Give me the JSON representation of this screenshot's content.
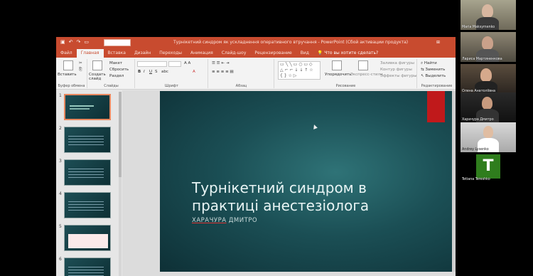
{
  "window": {
    "title": "Турнікетний синдром як ускладнення оперативного втручання - PowerPoint (Сбой активации продукта)",
    "tell_me": "Что вы хотите сделать?"
  },
  "tabs": [
    "Файл",
    "Главная",
    "Вставка",
    "Дизайн",
    "Переходы",
    "Анимация",
    "Слайд-шоу",
    "Рецензирование",
    "Вид"
  ],
  "active_tab": "Главная",
  "ribbon": {
    "clipboard": {
      "label": "Буфер обмена",
      "paste": "Вставить"
    },
    "slides": {
      "label": "Слайды",
      "new_slide": "Создать слайд",
      "layout": "Макет",
      "reset": "Сбросить",
      "section": "Раздел"
    },
    "font": {
      "label": "Шрифт"
    },
    "paragraph": {
      "label": "Абзац"
    },
    "drawing": {
      "label": "Рисование",
      "arrange": "Упорядочить",
      "quick_styles": "Экспресс-стили",
      "fill": "Заливка фигуры",
      "outline": "Контур фигуры",
      "effects": "Эффекты фигуры"
    },
    "editing": {
      "label": "Редактирование",
      "find": "Найти",
      "replace": "Заменить",
      "select": "Выделить"
    }
  },
  "thumbnails": [
    {
      "num": "1",
      "selected": true
    },
    {
      "num": "2",
      "selected": false
    },
    {
      "num": "3",
      "selected": false
    },
    {
      "num": "4",
      "selected": false
    },
    {
      "num": "5",
      "selected": false
    },
    {
      "num": "6",
      "selected": false
    }
  ],
  "slide": {
    "title": "Турнікетний синдром в практиці анестезіолога",
    "subtitle_first": "ХАРАЧУРА",
    "subtitle_second": "ДМИТРО",
    "accent_color": "#c0191b"
  },
  "participants": [
    {
      "name": "Maria Maksymenko"
    },
    {
      "name": "Лариса Мартиненкова"
    },
    {
      "name": "Олена Анатоліївна"
    },
    {
      "name": "Харачура Дмитро"
    },
    {
      "name": "Andrey Lysenko"
    },
    {
      "name": "Tetiana Tereshko",
      "initial": "T"
    }
  ]
}
